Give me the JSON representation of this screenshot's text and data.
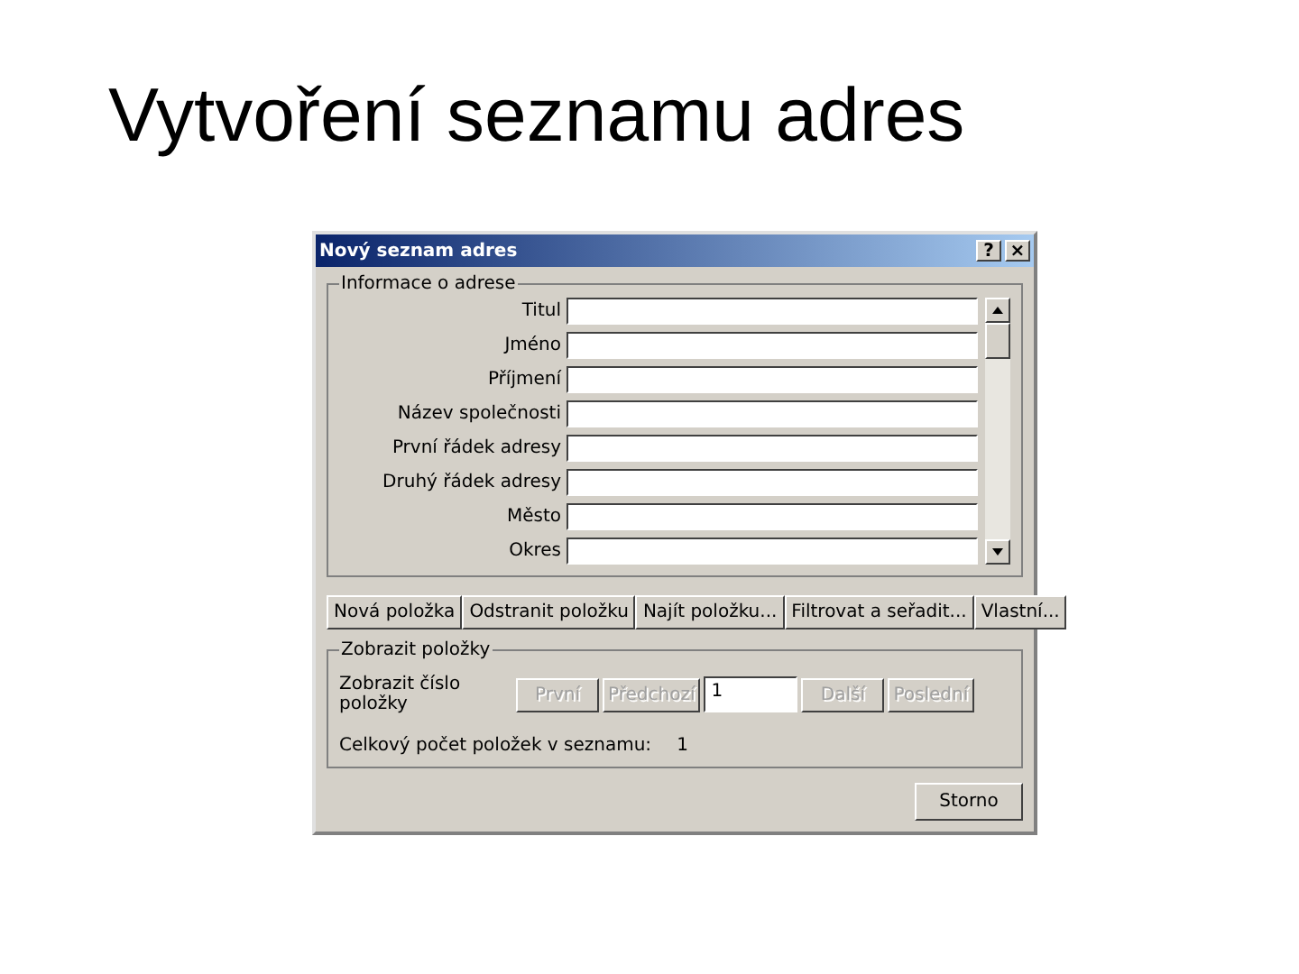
{
  "slide_title": "Vytvoření seznamu adres",
  "window": {
    "title": "Nový seznam adres",
    "help": "?",
    "close": "×"
  },
  "address_group": {
    "legend": "Informace o adrese",
    "fields": [
      {
        "label": "Titul"
      },
      {
        "label": "Jméno"
      },
      {
        "label": "Příjmení"
      },
      {
        "label": "Název společnosti"
      },
      {
        "label": "První řádek adresy"
      },
      {
        "label": "Druhý řádek adresy"
      },
      {
        "label": "Město"
      },
      {
        "label": "Okres"
      }
    ]
  },
  "actions": [
    {
      "label": "Nová položka"
    },
    {
      "label": "Odstranit položku"
    },
    {
      "label": "Najít položku..."
    },
    {
      "label": "Filtrovat a seřadit..."
    },
    {
      "label": "Vlastní..."
    }
  ],
  "view_group": {
    "legend": "Zobrazit položky",
    "label": "Zobrazit číslo položky",
    "nav": [
      {
        "kind": "button",
        "label": "První",
        "disabled": true
      },
      {
        "kind": "button",
        "label": "Předchozí",
        "disabled": true
      },
      {
        "kind": "input",
        "value": "1"
      },
      {
        "kind": "button",
        "label": "Další",
        "disabled": true
      },
      {
        "kind": "button",
        "label": "Poslední",
        "disabled": true
      }
    ],
    "total_label": "Celkový počet položek v seznamu:",
    "total": "1"
  },
  "buttons": [
    {
      "label": "Storno"
    }
  ]
}
